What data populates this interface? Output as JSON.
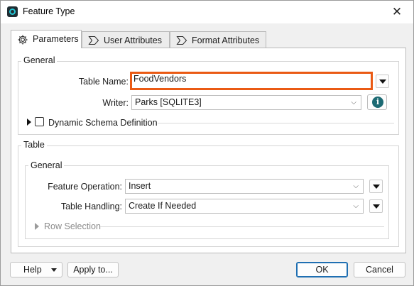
{
  "window": {
    "title": "Feature Type",
    "close_glyph": "✕"
  },
  "tabs": [
    {
      "label": "Parameters",
      "icon": "gear-icon",
      "active": true
    },
    {
      "label": "User Attributes",
      "icon": "chevron-tag-icon",
      "active": false
    },
    {
      "label": "Format Attributes",
      "icon": "chevron-tag-icon",
      "active": false
    }
  ],
  "general": {
    "title": "General",
    "table_name_label": "Table Name:",
    "table_name_value": "FoodVendors",
    "writer_label": "Writer:",
    "writer_value": "Parks [SQLITE3]",
    "dynamic_schema_label": "Dynamic Schema Definition",
    "dynamic_schema_checked": false
  },
  "table_section": {
    "title": "Table",
    "general": {
      "title": "General",
      "feature_operation_label": "Feature Operation:",
      "feature_operation_value": "Insert",
      "table_handling_label": "Table Handling:",
      "table_handling_value": "Create If Needed",
      "row_selection_label": "Row Selection"
    }
  },
  "footer": {
    "help_label": "Help",
    "apply_label": "Apply to...",
    "ok_label": "OK",
    "cancel_label": "Cancel"
  },
  "colors": {
    "highlight": "#ea5a14",
    "primary_border": "#1f6fb2",
    "info_icon": "#1c6a73"
  },
  "glyphs": {
    "combo_chevron": "⌵"
  }
}
